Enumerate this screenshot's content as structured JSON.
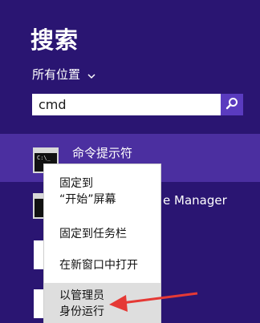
{
  "header": {
    "title": "搜索",
    "scope_label": "所有位置"
  },
  "search": {
    "value": "cmd"
  },
  "results": [
    {
      "label": "命令提示符"
    },
    {
      "label": "e Manager"
    }
  ],
  "context_menu": {
    "items": [
      {
        "line1": "固定到",
        "line2": "“开始”屏幕"
      },
      {
        "line1": "固定到任务栏"
      },
      {
        "line1": "在新窗口中打开"
      },
      {
        "line1": "以管理员",
        "line2": "身份运行"
      }
    ]
  },
  "colors": {
    "background": "#2a1572",
    "selected_row": "#4b2fa0",
    "search_button": "#5a3bbf",
    "arrow": "#e53935"
  },
  "icons": {
    "search_button": "magnifier-icon",
    "scope_dropdown": "chevron-down-icon",
    "result_icon": "command-prompt-icon"
  }
}
